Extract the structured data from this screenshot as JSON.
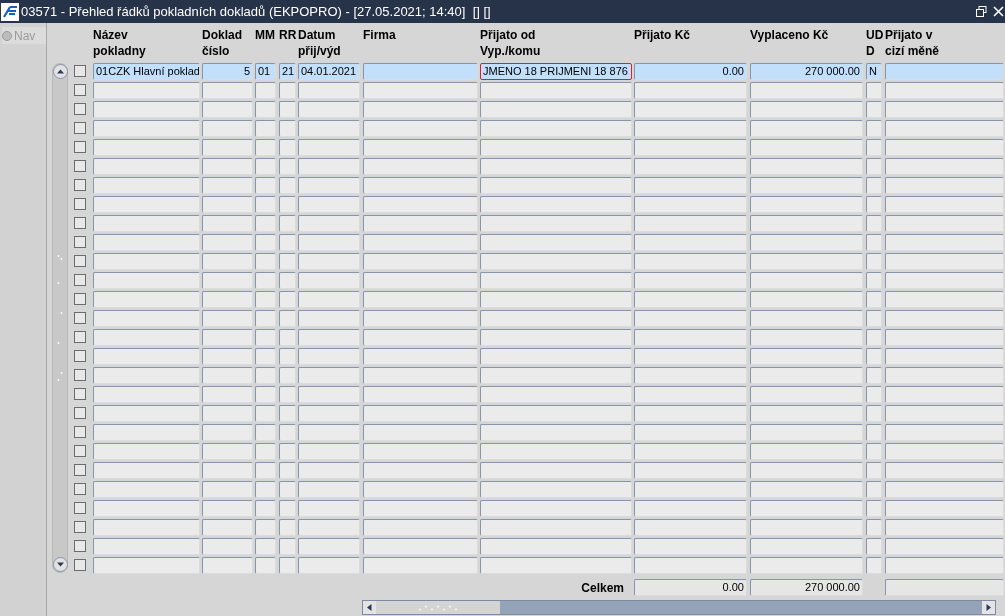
{
  "window": {
    "title": "03571 - Přehled řádků pokladních dokladů (EKPOPRO) - [27.05.2021; 14:40]  [] []"
  },
  "nav": {
    "label": "Nav",
    "disabled": true,
    "selected": false
  },
  "table": {
    "columns": [
      {
        "label": "Název\npokladny"
      },
      {
        "label": "Doklad\nčíslo"
      },
      {
        "label": "MM"
      },
      {
        "label": "RR"
      },
      {
        "label": "Datum\npřij/výd"
      },
      {
        "label": "Firma"
      },
      {
        "label": "Přijato od\nVyp./komu"
      },
      {
        "label": "Přijato Kč"
      },
      {
        "label": "Vyplaceno Kč"
      },
      {
        "label": "UD\nD"
      },
      {
        "label": "Přijato v\ncizí měně"
      }
    ],
    "rows": [
      {
        "selected": true,
        "checked": false,
        "cells": [
          {
            "text": "01CZK  Hlavní poklad",
            "focused": false
          },
          {
            "text": "5",
            "focused": false
          },
          {
            "text": "01",
            "focused": false
          },
          {
            "text": "21",
            "focused": false
          },
          {
            "text": "04.01.2021",
            "focused": false
          },
          {
            "focused": false
          },
          {
            "text": "JMENO 18 PRIJMENI 18 876",
            "focused": true
          },
          {
            "text": "0.00",
            "focused": false
          },
          {
            "text": "270 000.00",
            "focused": false
          },
          {
            "text": "N",
            "focused": false
          },
          {
            "focused": false
          }
        ]
      },
      {
        "selected": false,
        "checked": false
      },
      {
        "selected": false,
        "checked": false
      },
      {
        "selected": false,
        "checked": false
      },
      {
        "selected": false,
        "checked": false
      },
      {
        "selected": false,
        "checked": false
      },
      {
        "selected": false,
        "checked": false
      },
      {
        "selected": false,
        "checked": false
      },
      {
        "selected": false,
        "checked": false
      },
      {
        "selected": false,
        "checked": false
      },
      {
        "selected": false,
        "checked": false
      },
      {
        "selected": false,
        "checked": false
      },
      {
        "selected": false,
        "checked": false
      },
      {
        "selected": false,
        "checked": false
      },
      {
        "selected": false,
        "checked": false
      },
      {
        "selected": false,
        "checked": false
      },
      {
        "selected": false,
        "checked": false
      },
      {
        "selected": false,
        "checked": false
      },
      {
        "selected": false,
        "checked": false
      },
      {
        "selected": false,
        "checked": false
      },
      {
        "selected": false,
        "checked": false
      },
      {
        "selected": false,
        "checked": false
      },
      {
        "selected": false,
        "checked": false
      },
      {
        "selected": false,
        "checked": false
      },
      {
        "selected": false,
        "checked": false
      },
      {
        "selected": false,
        "checked": false
      },
      {
        "selected": false,
        "checked": false
      }
    ],
    "totals": {
      "label": "Celkem",
      "prijato_kc": "0.00",
      "vyplaceno_kc": "270 000.00"
    }
  }
}
